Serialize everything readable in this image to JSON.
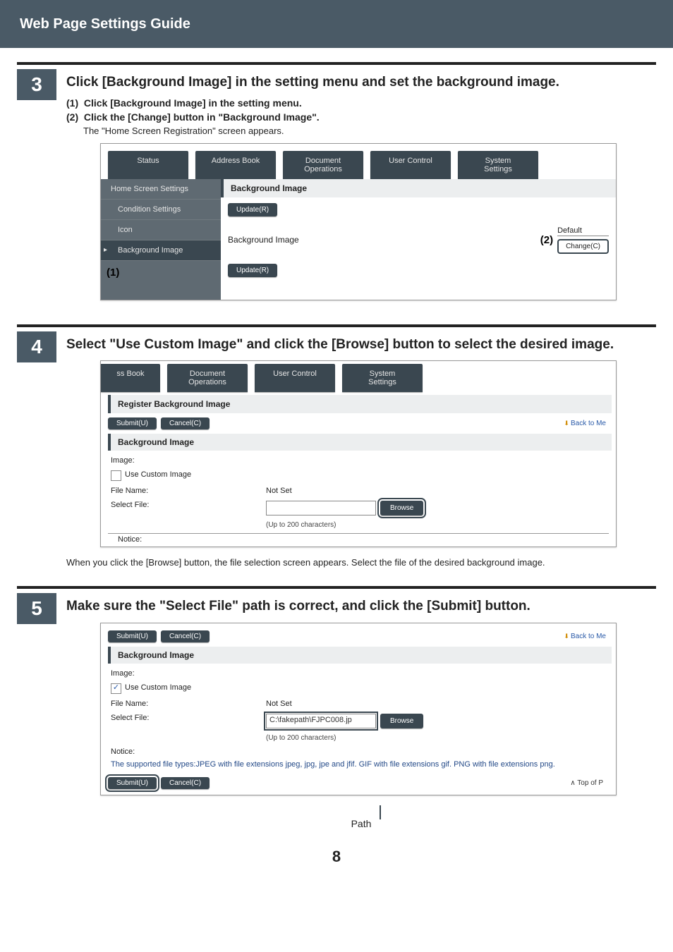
{
  "header": {
    "title": "Web Page Settings Guide"
  },
  "pageNumber": "8",
  "step3": {
    "number": "3",
    "title": "Click [Background Image] in the setting menu and set the background image.",
    "sub1_no": "(1)",
    "sub1": "Click [Background Image] in the setting menu.",
    "sub2_no": "(2)",
    "sub2": "Click the [Change] button in \"Background Image\".",
    "body": "The \"Home Screen Registration\" screen appears.",
    "tabs": {
      "status": "Status",
      "addressBook": "Address Book",
      "docOps": "Document\nOperations",
      "userControl": "User Control",
      "system": "System\nSettings"
    },
    "side": {
      "home": "Home Screen Settings",
      "cond": "Condition Settings",
      "icon": "Icon",
      "bg": "Background Image"
    },
    "annot1": "(1)",
    "panelTitle": "Background Image",
    "update": "Update(R)",
    "rowLabel": "Background Image",
    "annot2": "(2)",
    "default": "Default",
    "change": "Change(C)"
  },
  "step4": {
    "number": "4",
    "title": "Select \"Use Custom Image\" and click the [Browse] button to select the desired image.",
    "tabs": {
      "book": "ss Book",
      "docOps": "Document\nOperations",
      "userControl": "User Control",
      "system": "System\nSettings"
    },
    "panelTitle": "Register Background Image",
    "submit": "Submit(U)",
    "cancel": "Cancel(C)",
    "backLink": "Back to Me",
    "panelSub": "Background Image",
    "imageLabel": "Image:",
    "useCustom": "Use Custom Image",
    "fileName": "File Name:",
    "fileNameVal": "Not Set",
    "selectFile": "Select File:",
    "browse": "Browse",
    "chars": "(Up to 200 characters)",
    "noticeLabel": "Notice:",
    "caption": "When you click the [Browse] button, the file selection screen appears. Select the file of the desired background image."
  },
  "step5": {
    "number": "5",
    "title": "Make sure the \"Select File\" path is correct, and click the [Submit] button.",
    "submit": "Submit(U)",
    "cancel": "Cancel(C)",
    "backLink": "Back to Me",
    "panelSub": "Background Image",
    "imageLabel": "Image:",
    "useCustom": "Use Custom Image",
    "fileName": "File Name:",
    "fileNameVal": "Not Set",
    "selectFile": "Select File:",
    "path": "C:\\fakepath\\FJPC008.jp",
    "browse": "Browse",
    "chars": "(Up to 200 characters)",
    "noticeLabel": "Notice:",
    "notice": "The supported file types:JPEG with file extensions jpeg, jpg, jpe and jfif. GIF with file extensions gif. PNG with file extensions png.",
    "topLink": "Top of P",
    "pathLabel": "Path"
  }
}
